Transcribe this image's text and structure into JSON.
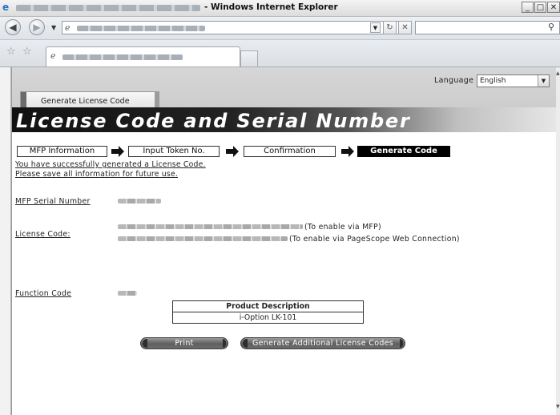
{
  "browser": {
    "window_title": "- Windows Internet Explorer",
    "min_icon": "_",
    "max_icon": "□",
    "refresh_icon": "↻",
    "stop_icon": "✕",
    "search_icon_glyph": "⚲"
  },
  "page": {
    "language_label": "Language",
    "language_value": "English",
    "top_tab_label": "Generate License Code",
    "heading": "License Code and Serial Number",
    "steps": [
      {
        "label": "MFP Information",
        "active": false
      },
      {
        "label": "Input Token No.",
        "active": false
      },
      {
        "label": "Confirmation",
        "active": false
      },
      {
        "label": "Generate Code",
        "active": true
      }
    ],
    "success_message": "You have successfully generated a License Code.",
    "save_message": "Please save all information for future use.",
    "fields": {
      "serial_label": "MFP Serial Number",
      "license_label": "License Code:",
      "license_note_1": "(To enable via MFP)",
      "license_note_2": "(To enable via PageScope Web Connection)",
      "function_label": "Function Code"
    },
    "product_table": {
      "header": "Product Description",
      "value": "i-Option LK-101"
    },
    "buttons": {
      "print": "Print",
      "generate_additional": "Generate Additional License Codes"
    }
  },
  "colors": {
    "heading_band_start": "#111111",
    "active_step": "#000000",
    "button_gray": "#5e5e5e"
  }
}
